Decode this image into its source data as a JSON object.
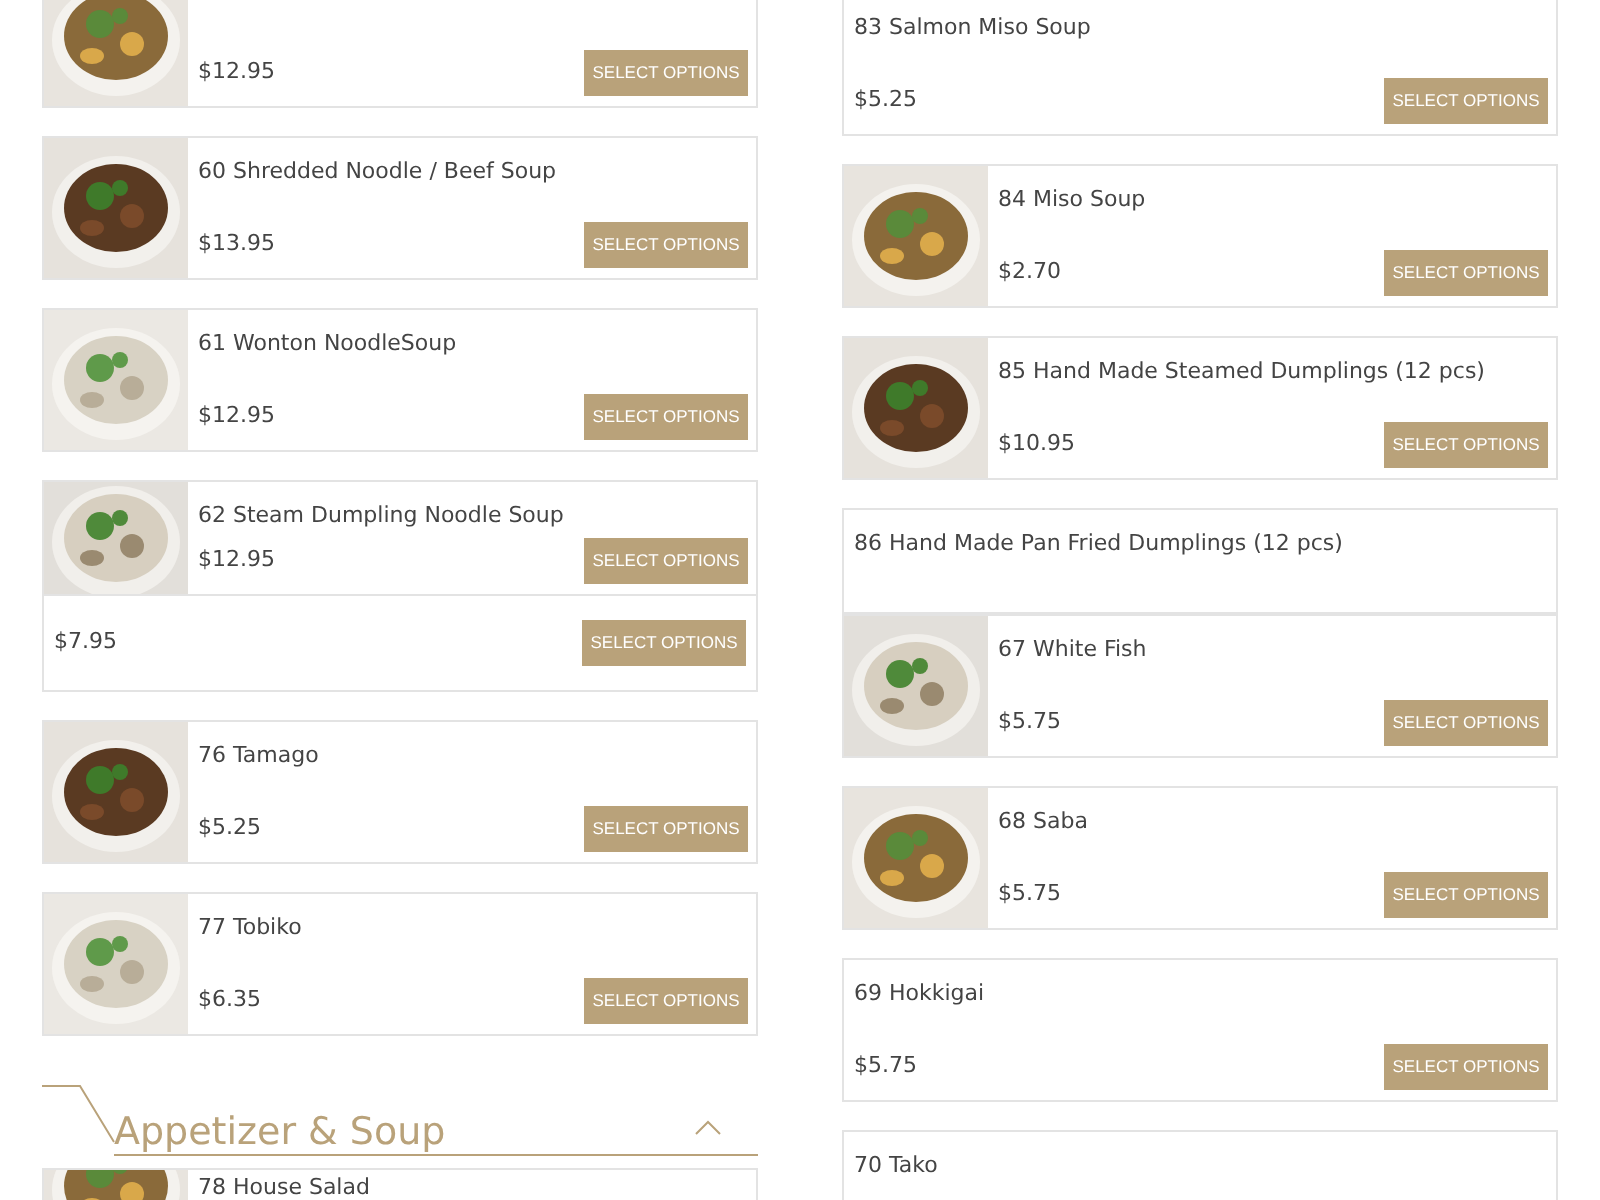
{
  "columns": [
    {
      "cards": [
        {
          "price": "$12.95",
          "button": "SELECT OPTIONS"
        },
        {
          "name": "60 Shredded Noodle / Beef Soup",
          "price": "$13.95",
          "button": "SELECT OPTIONS"
        },
        {
          "name": "61 Wonton NoodleSoup",
          "price": "$12.95",
          "button": "SELECT OPTIONS"
        },
        {
          "kind": "image_clipped",
          "name": "62 Steam Dumpling Noodle Soup",
          "price": "$12.95",
          "button": "SELECT OPTIONS"
        },
        {
          "kind": "price_only",
          "price": "$7.95",
          "button": "SELECT OPTIONS"
        },
        {
          "name": "76 Tamago",
          "price": "$5.25",
          "button": "SELECT OPTIONS"
        },
        {
          "name": "77 Tobiko",
          "price": "$6.35",
          "button": "SELECT OPTIONS"
        },
        {
          "kind": "section",
          "title": "Appetizer & Soup",
          "expanded": true
        },
        {
          "kind": "image_top",
          "name": "78 House Salad"
        }
      ]
    },
    {
      "cards": [
        {
          "kind": "plain",
          "name": "83 Salmon Miso Soup",
          "price": "$5.25",
          "button": "SELECT OPTIONS"
        },
        {
          "name": "84 Miso Soup",
          "price": "$2.70",
          "button": "SELECT OPTIONS"
        },
        {
          "name": "85 Hand Made Steamed Dumplings (12 pcs)",
          "price": "$10.95",
          "button": "SELECT OPTIONS"
        },
        {
          "kind": "plain_clipped",
          "name": "86 Hand Made Pan Fried Dumplings (12 pcs)"
        },
        {
          "name": "67 White Fish",
          "price": "$5.75",
          "button": "SELECT OPTIONS"
        },
        {
          "name": "68 Saba",
          "price": "$5.75",
          "button": "SELECT OPTIONS"
        },
        {
          "kind": "plain",
          "name": "69 Hokkigai",
          "price": "$5.75",
          "button": "SELECT OPTIONS"
        },
        {
          "kind": "plain",
          "name": "70 Tako"
        }
      ]
    }
  ]
}
